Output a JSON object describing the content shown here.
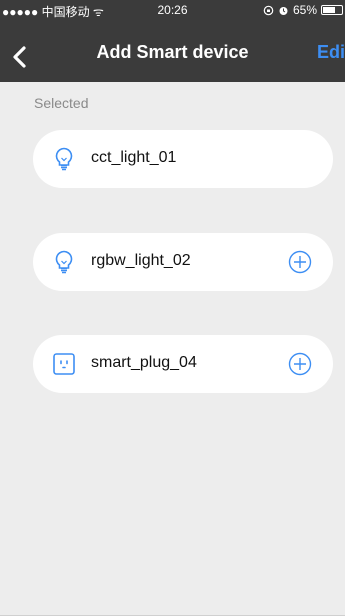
{
  "status_bar": {
    "carrier": "●●●●● 中国移动 ᯤ",
    "time": "20:26",
    "icons": [
      "orientation-lock-icon",
      "alarm-icon"
    ],
    "battery_text": "65%",
    "battery_level": 0.65
  },
  "nav": {
    "title": "Add Smart device",
    "edit_label": "Edit",
    "back_icon": "chevron-left-icon"
  },
  "section_label": "Selected",
  "devices": [
    {
      "name": "cct_light_01",
      "icon": "lightbulb-icon",
      "selected": true
    },
    {
      "name": "rgbw_light_02",
      "icon": "lightbulb-icon",
      "selected": false
    },
    {
      "name": "smart_plug_04",
      "icon": "plug-icon",
      "selected": false
    }
  ],
  "colors": {
    "accent": "#3d8ef3",
    "header_bg": "#3b3b3b",
    "page_bg": "#ededed",
    "card_bg": "#ffffff"
  }
}
